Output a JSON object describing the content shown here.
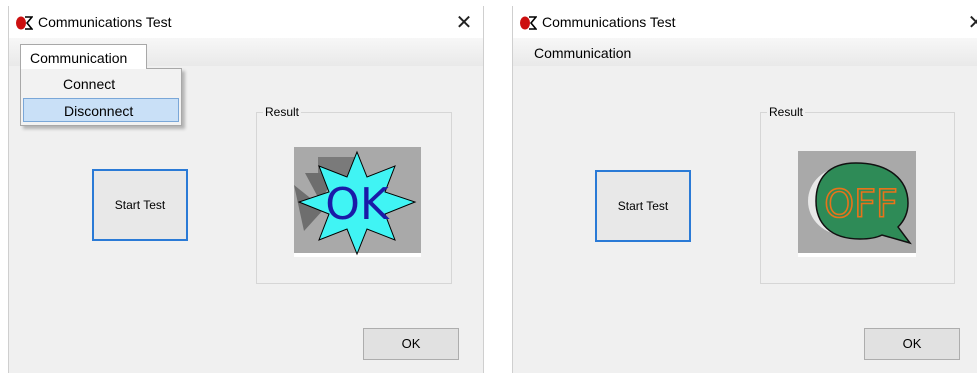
{
  "window_1": {
    "title": "Communications Test",
    "close_glyph": "✕",
    "menu": {
      "label": "Communication",
      "state": "open",
      "items": [
        {
          "label": "Connect"
        },
        {
          "label": "Disconnect",
          "highlighted": true
        }
      ]
    },
    "start_button": "Start Test",
    "result_group": "Result",
    "result_image": {
      "icon": "ok-starburst-icon",
      "text": "OK"
    },
    "ok_button": "OK"
  },
  "window_2": {
    "title": "Communications Test",
    "close_glyph": "✕",
    "menu": {
      "label": "Communication",
      "state": "closed"
    },
    "start_button": "Start Test",
    "result_group": "Result",
    "result_image": {
      "icon": "off-bubble-icon",
      "text": "OFF"
    },
    "ok_button": "OK"
  },
  "colors": {
    "start_button_border": "#2a7ad6",
    "menu_highlight": "#c9e0f7",
    "ok_badge_fill": "#40f4f4",
    "ok_badge_text": "#1a1aa8",
    "off_badge_fill": "#2e8b57",
    "off_badge_text": "#e8731a"
  }
}
